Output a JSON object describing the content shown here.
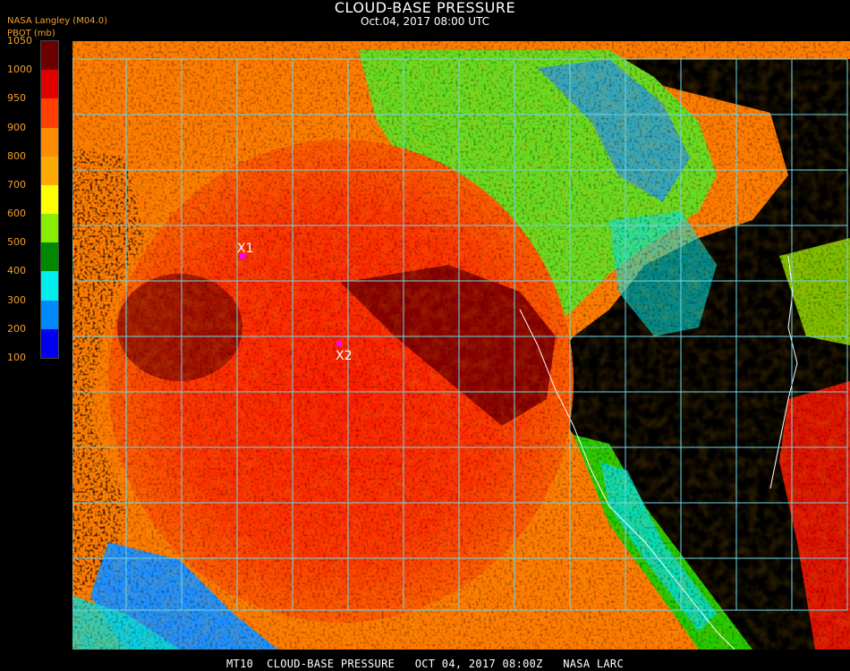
{
  "header": {
    "title": "CLOUD-BASE PRESSURE",
    "subtitle": "Oct.04, 2017 08:00 UTC",
    "source": "NASA Langley (M04.0)",
    "variable": "PBOT (mb)"
  },
  "legend": {
    "ticks": [
      "1050",
      "1000",
      "950",
      "900",
      "800",
      "700",
      "600",
      "500",
      "400",
      "300",
      "200",
      "100"
    ],
    "colors": [
      "#6a0000",
      "#e00000",
      "#ff4000",
      "#ff8c00",
      "#ffaa00",
      "#ffff00",
      "#88ee00",
      "#008800",
      "#00eeee",
      "#0088ff",
      "#0000ee",
      "#9933cc"
    ]
  },
  "map": {
    "colors": {
      "grid": "#6fd6e8",
      "marker": "#ff00ff",
      "no_cloud": "#000000",
      "coast": "#ffffff"
    },
    "markers": [
      {
        "label": "X1"
      },
      {
        "label": "X2"
      }
    ]
  },
  "footer": {
    "text": "MT10  CLOUD-BASE PRESSURE   OCT 04, 2017 08:00Z   NASA LARC"
  }
}
